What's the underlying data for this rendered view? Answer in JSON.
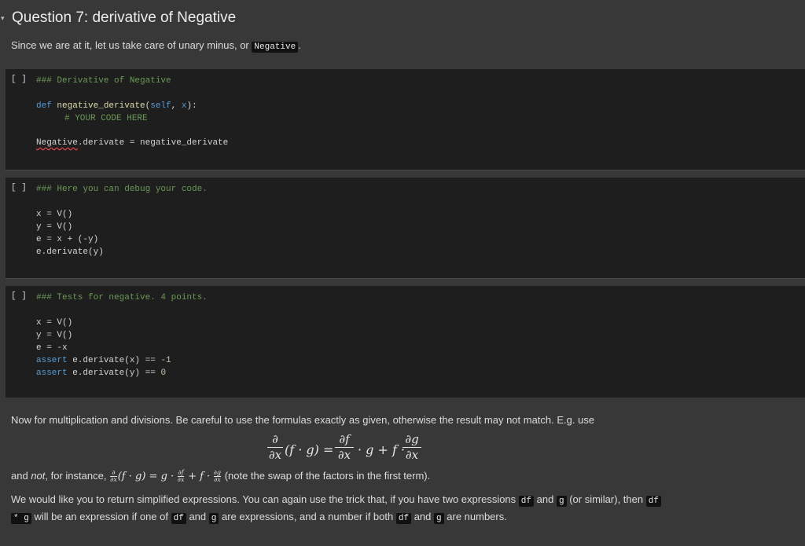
{
  "heading": {
    "caret": "▾",
    "title": "Question 7: derivative of Negative"
  },
  "intro": {
    "text": "Since we are at it, let us take care of unary minus, or",
    "code": "Negative",
    "end": "."
  },
  "cells": [
    {
      "run": "[ ]",
      "lines": [
        "### Derivative of Negative",
        "def negative_derivate(self, x):",
        "# YOUR CODE HERE",
        "Negative.derivate = negative_derivate"
      ]
    },
    {
      "run": "[ ]",
      "lines": [
        "### Here you can debug your code.",
        "x = V()",
        "y = V()",
        "e = x + (-y)",
        "e.derivate(y)"
      ]
    },
    {
      "run": "[ ]",
      "lines": [
        "### Tests for negative. 4 points.",
        "x = V()",
        "y = V()",
        "e = -x",
        "assert e.derivate(x) == -1",
        "assert e.derivate(y) == 0"
      ]
    }
  ],
  "mult": {
    "text": "Now for multiplication and divisions. Be careful to use the formulas exactly as given, otherwise the result may not match. E.g. use"
  },
  "formula": {
    "partial": "∂",
    "dx": "∂x",
    "df": "∂f",
    "dg": "∂g",
    "lhs": "(f · g) =",
    "mid": "· g + f ·"
  },
  "not_line": {
    "pre": "and",
    "not_word": "not",
    "mid": ", for instance,",
    "expr_a": "(f · g) = g ·",
    "expr_b": "+ f ·",
    "post": "(note the swap of the factors in the first term)."
  },
  "simplify": {
    "line1_a": "We would like you to return simplified expressions. You can again use the trick that, if you have two expressions",
    "df": "df",
    "and": "and",
    "g": "g",
    "line1_b": "(or similar), then",
    "star_g": "* g",
    "line2_a": "will be an expression if one of",
    "line2_b": "are expressions, and a number if both",
    "line2_c": "are numbers."
  }
}
